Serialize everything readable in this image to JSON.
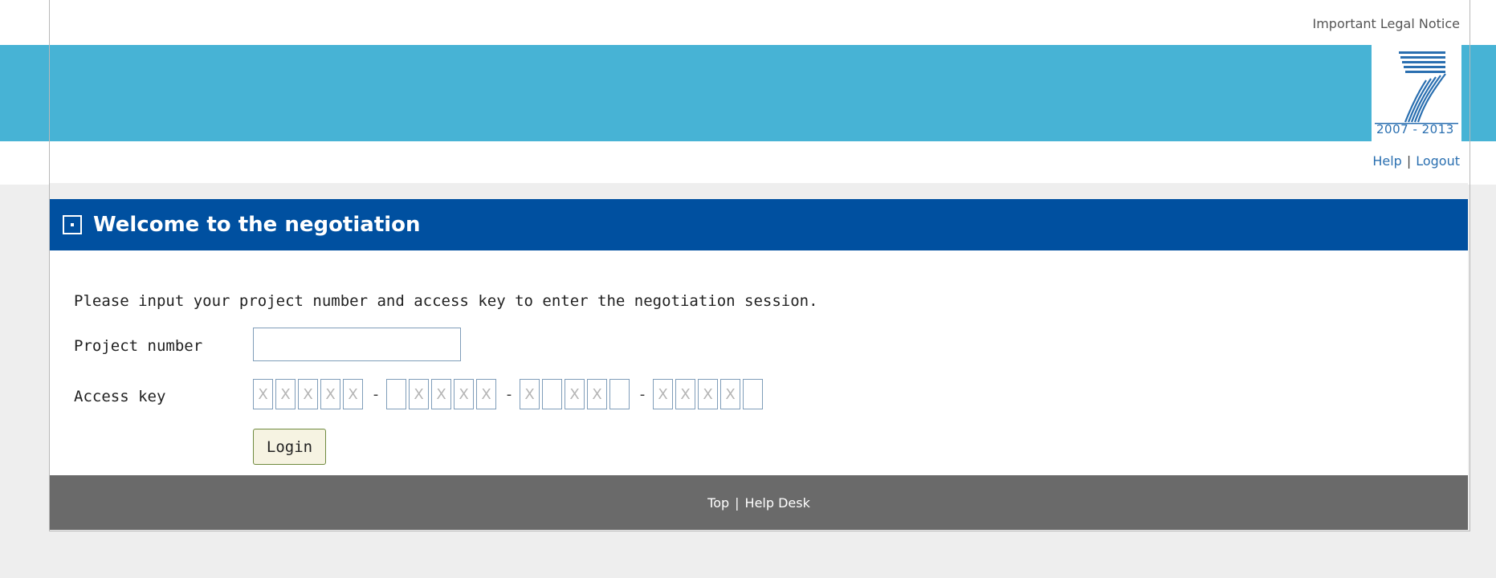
{
  "header": {
    "legal_notice": "Important Legal Notice",
    "logo_years": "2007 - 2013",
    "links": [
      "Help",
      "Logout"
    ],
    "separator": "|"
  },
  "panel": {
    "title": "Welcome to the negotiation",
    "instructions": "Please input your project number and access key to enter the negotiation session.",
    "project_label": "Project number",
    "project_value": "",
    "access_label": "Access key",
    "access_key_groups": [
      [
        "X",
        "X",
        "X",
        "X",
        "X"
      ],
      [
        "",
        "X",
        "X",
        "X",
        "X"
      ],
      [
        "X",
        "",
        "X",
        "X",
        ""
      ],
      [
        "X",
        "X",
        "X",
        "X",
        ""
      ]
    ],
    "group_separator": "-",
    "login_label": "Login"
  },
  "footer": {
    "links": [
      "Top",
      "Help Desk"
    ],
    "separator": "|"
  },
  "colors": {
    "banner": "#47b3d5",
    "title_bar": "#0050a0",
    "footer": "#6a6a6a",
    "background": "#eeeeee",
    "link": "#2a6fb0"
  },
  "icons": {
    "collapse": "collapse-square-icon",
    "logo": "fp7-logo-icon"
  }
}
